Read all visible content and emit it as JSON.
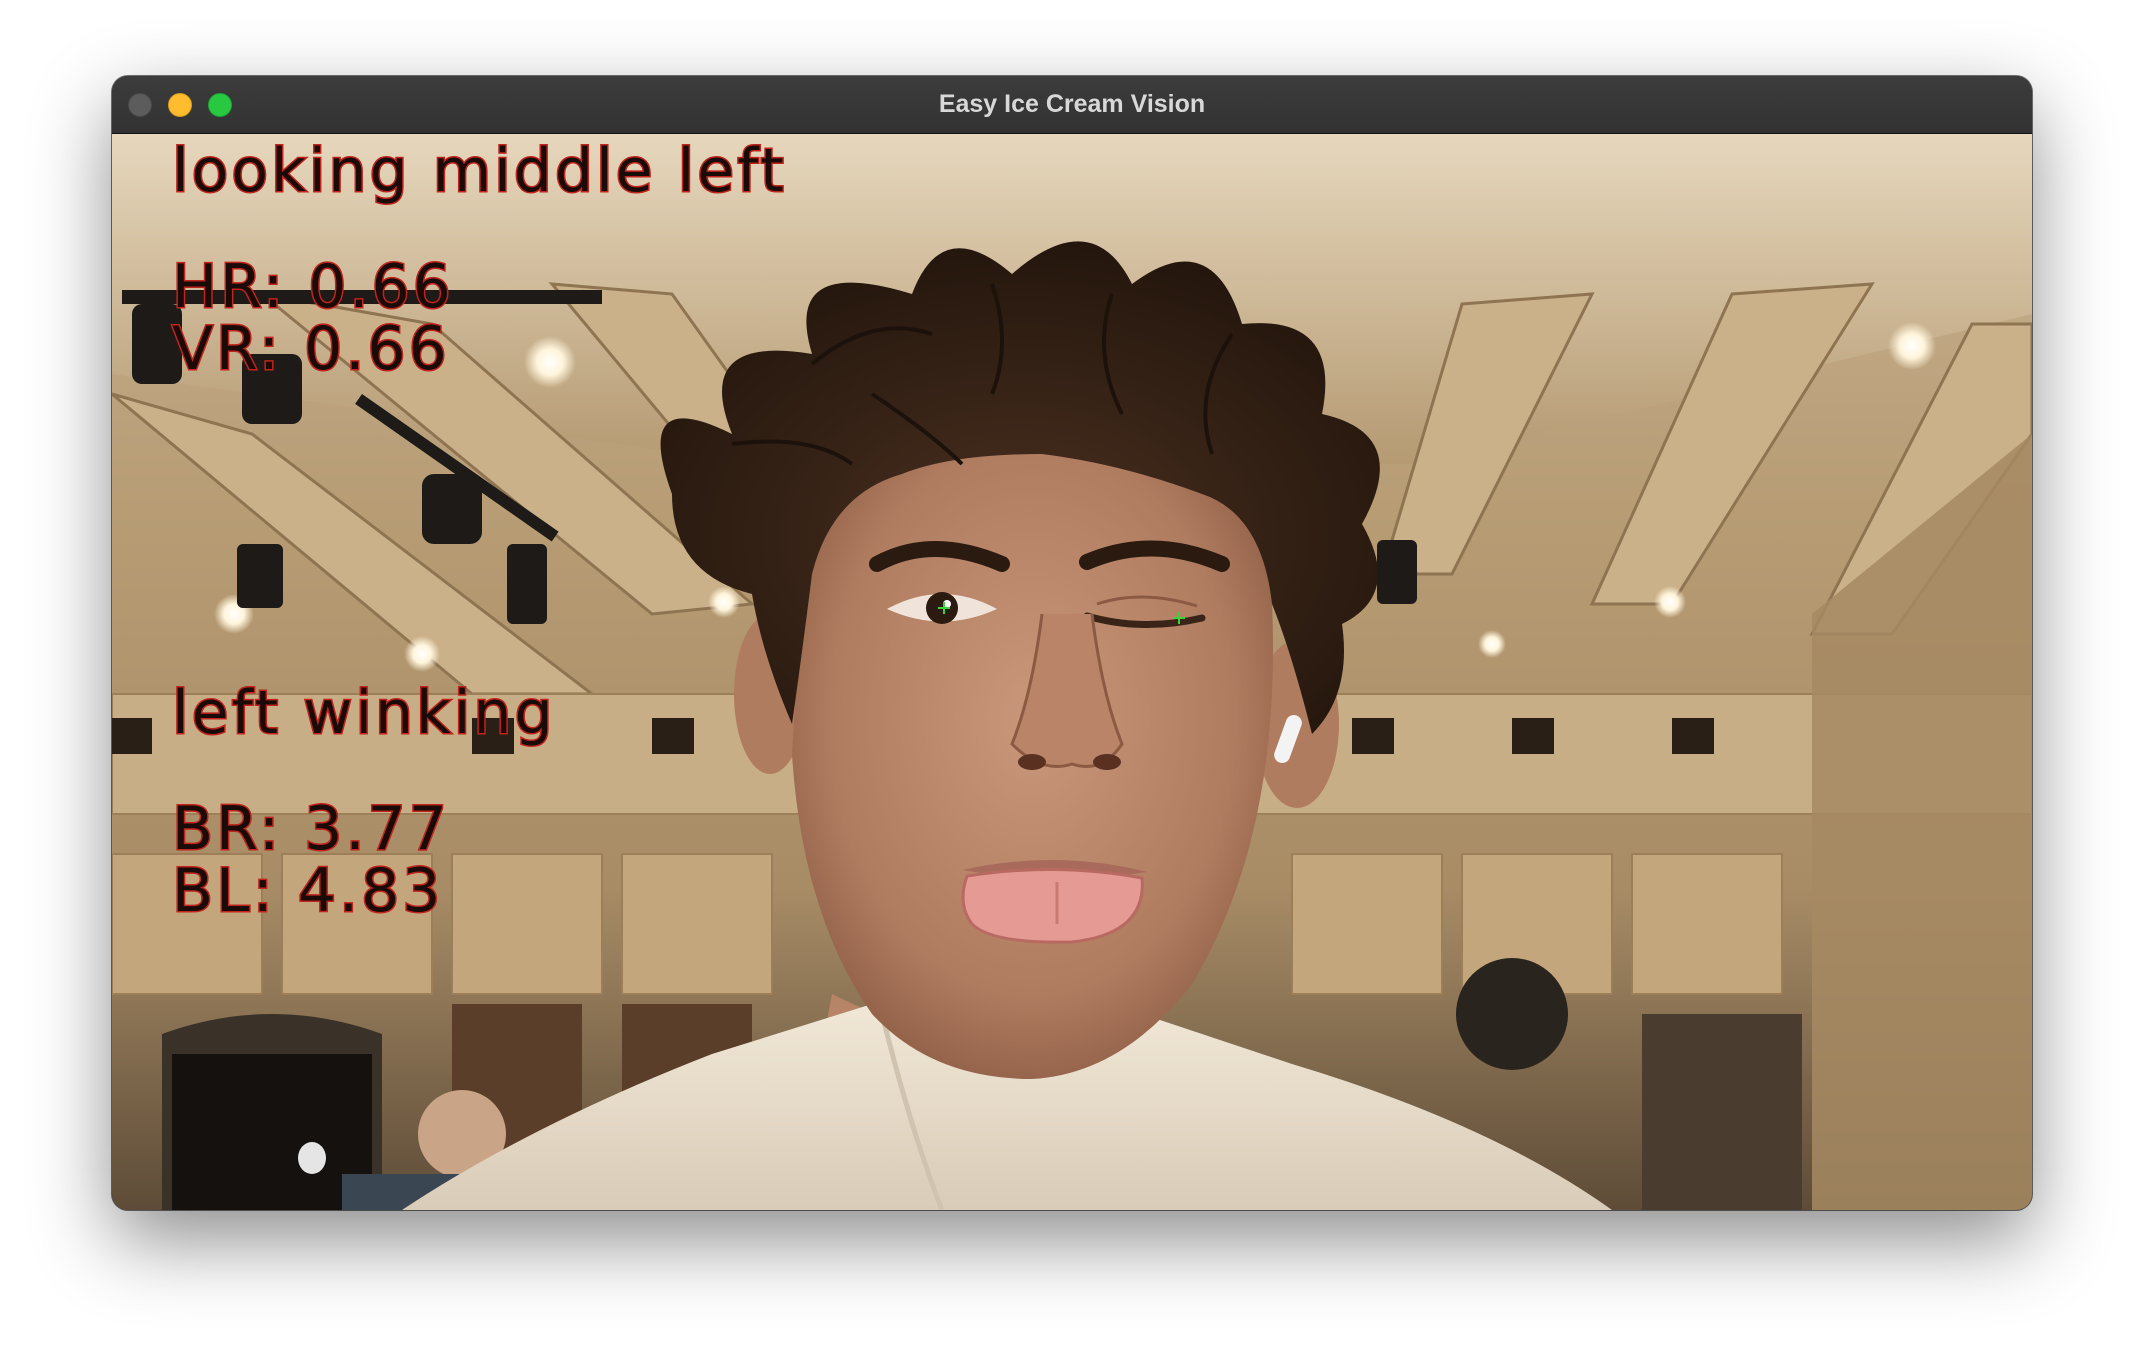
{
  "window": {
    "title": "Easy Ice Cream Vision"
  },
  "overlay": {
    "gaze_label": "looking middle left",
    "hr": "HR: 0.66",
    "vr": "VR: 0.66",
    "blink_label": "left winking",
    "br": "BR: 3.77",
    "bl": "BL: 4.83"
  },
  "colors": {
    "overlay_outline": "#c0241c",
    "overlay_fill": "#1a0a08",
    "pupil_marker": "#3cd23c",
    "titlebar": "#363636",
    "close_button": "#5c5c5c",
    "minimize_button": "#febc2e",
    "maximize_button": "#28c840"
  }
}
